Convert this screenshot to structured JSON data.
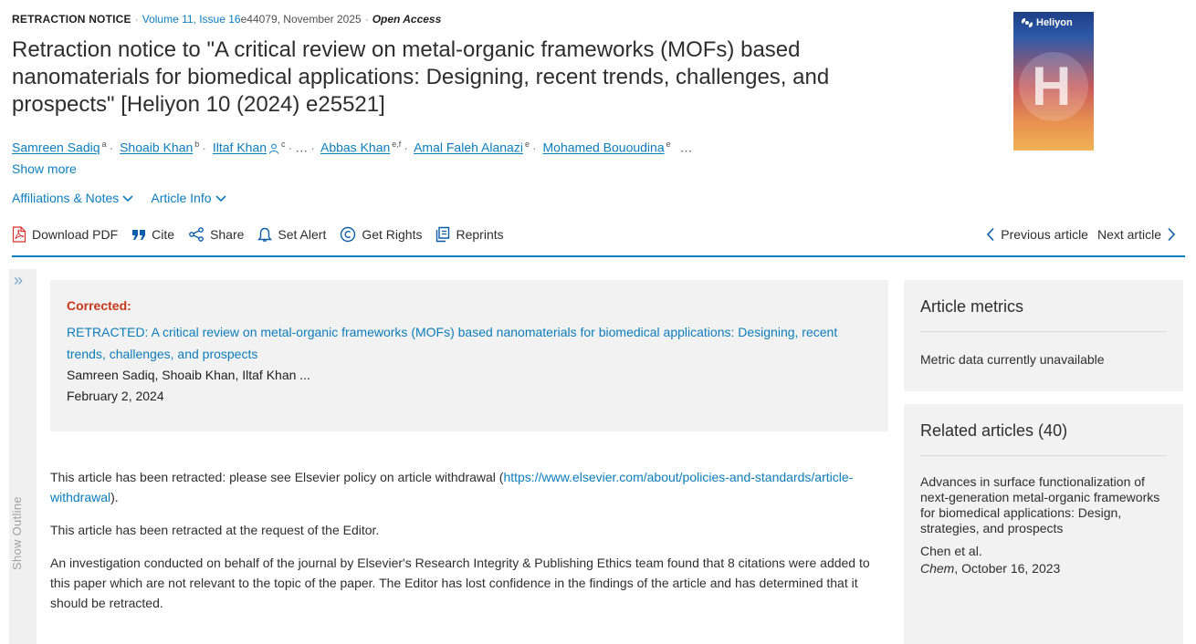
{
  "meta": {
    "kind": "RETRACTION NOTICE",
    "volume": "Volume 11, Issue 16",
    "article_id": "e44079, November 2025",
    "access": "Open Access"
  },
  "title": "Retraction notice to \"A critical review on metal-organic frameworks (MOFs) based nanomaterials for biomedical applications: Designing, recent trends, challenges, and prospects\" [Heliyon 10 (2024) e25521]",
  "authors": [
    {
      "name": "Samreen Sadiq",
      "sup": "a"
    },
    {
      "name": "Shoaib Khan",
      "sup": "b"
    },
    {
      "name": "Iltaf Khan",
      "sup": "c"
    },
    {
      "name": "Abbas Khan",
      "sup": "e,f"
    },
    {
      "name": "Amal Faleh Alanazi",
      "sup": "e"
    },
    {
      "name": "Mohamed Bououdina",
      "sup": "e"
    }
  ],
  "authors_ellipsis": "…",
  "show_more": "Show more",
  "affiliations_label": "Affiliations & Notes",
  "article_info_label": "Article Info",
  "toolbar": {
    "download_pdf": "Download PDF",
    "cite": "Cite",
    "share": "Share",
    "set_alert": "Set Alert",
    "get_rights": "Get Rights",
    "reprints": "Reprints"
  },
  "nav": {
    "previous": "Previous article",
    "next": "Next article"
  },
  "outline": {
    "label": "Show Outline"
  },
  "corrected": {
    "label": "Corrected:",
    "link": "RETRACTED: A critical review on metal-organic frameworks (MOFs) based nanomaterials for biomedical applications: Designing, recent trends, challenges, and prospects",
    "authors": "Samreen Sadiq, Shoaib Khan, Iltaf Khan ...",
    "date": "February 2, 2024"
  },
  "body": {
    "p1_text": "This article has been retracted: please see Elsevier policy on article withdrawal (",
    "p1_link": "https://www.elsevier.com/about/policies-and-standards/article-withdrawal",
    "p1_end": ").",
    "p2": "This article has been retracted at the request of the Editor.",
    "p3": "An investigation conducted on behalf of the journal by Elsevier's Research Integrity & Publishing Ethics team found that 8 citations were added to this paper which are not relevant to the topic of the paper. The Editor has lost confidence in the findings of the article and has determined that it should be retracted."
  },
  "cover": {
    "brand": "Heliyon",
    "letter": "H"
  },
  "metrics": {
    "title": "Article metrics",
    "text": "Metric data currently unavailable"
  },
  "related": {
    "title": "Related articles (40)",
    "item_title": "Advances in surface functionalization of next-generation metal-organic frameworks for biomedical applications: Design, strategies, and prospects",
    "item_authors": "Chen et al.",
    "item_journal": "Chem",
    "item_date": ", October 16, 2023"
  },
  "colors": {
    "link": "#0c7dbb",
    "corrected_label": "#c8361a",
    "pdf_icon": "#d9302b",
    "panel_bg": "#f2f2f2"
  }
}
